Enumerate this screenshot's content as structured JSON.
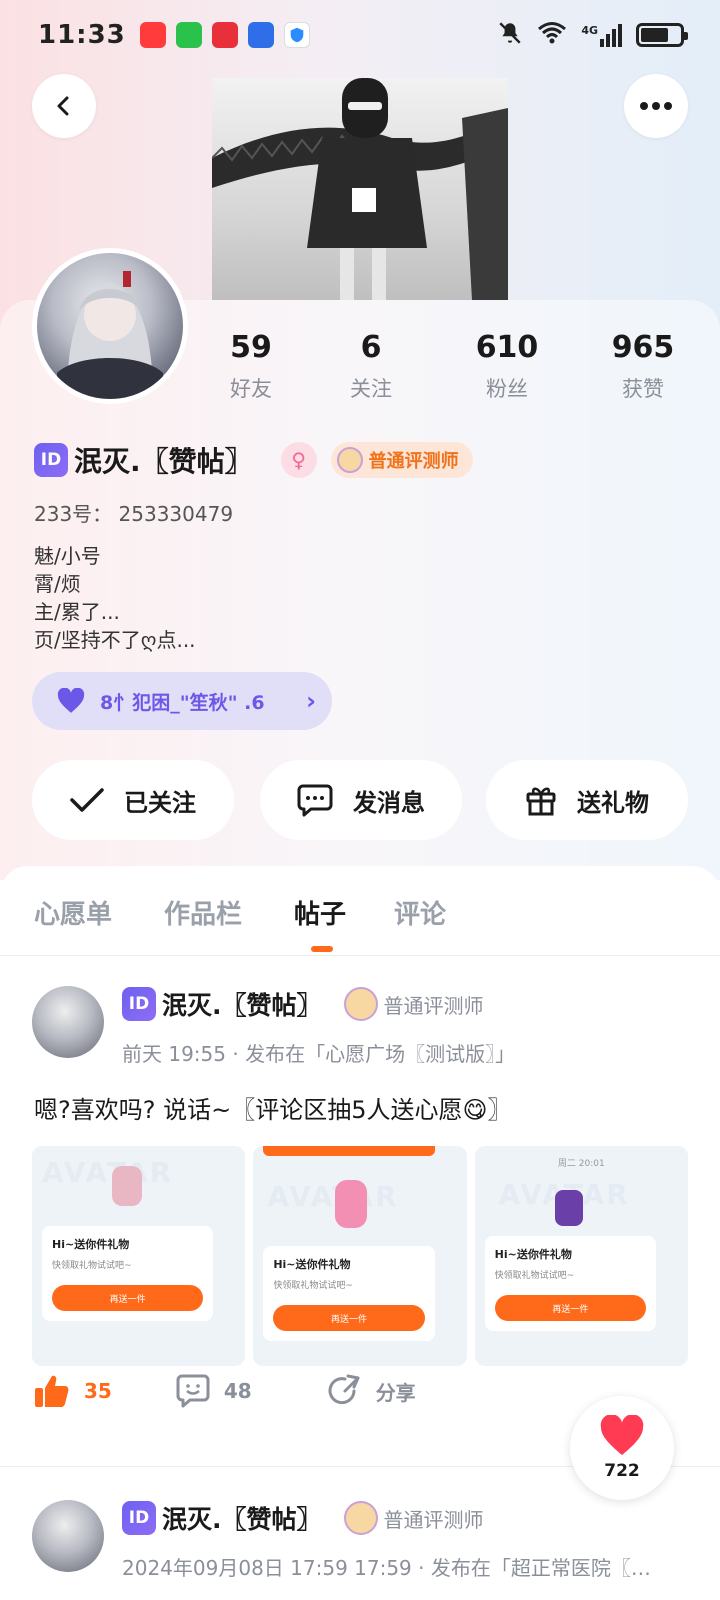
{
  "status_bar": {
    "time": "11:33",
    "network": "4G",
    "apps": [
      {
        "name": "app-icon-1",
        "color": "#ff3b3b",
        "label": ""
      },
      {
        "name": "app-icon-2",
        "color": "#2bc24b",
        "label": ""
      },
      {
        "name": "app-icon-3",
        "color": "#e8303a",
        "label": ""
      },
      {
        "name": "app-icon-4",
        "color": "#2f6ee8",
        "label": ""
      },
      {
        "name": "app-icon-5",
        "color": "#2a8cff",
        "label": ""
      }
    ]
  },
  "profile": {
    "stats": [
      {
        "value": "59",
        "label": "好友"
      },
      {
        "value": "6",
        "label": "关注"
      },
      {
        "value": "610",
        "label": "粉丝"
      },
      {
        "value": "965",
        "label": "获赞"
      }
    ],
    "id_badge": "ID",
    "name": "泯灭.〖赞帖〗",
    "gender_symbol": "♀",
    "role": "普通评测师",
    "uid": "233号：  253330479",
    "bio": [
      "魅/小号",
      "霄/烦",
      "主/累了...",
      "页/坚持不了ღ点..."
    ],
    "guild": "8忄犯困_\"笙秋\" .6",
    "actions": {
      "follow": "已关注",
      "message": "发消息",
      "gift": "送礼物"
    }
  },
  "tabs": [
    "心愿单",
    "作品栏",
    "帖子",
    "评论"
  ],
  "active_tab": "帖子",
  "posts": [
    {
      "author": "泯灭.〖赞帖〗",
      "role": "普通评测师",
      "meta": "前天 19:55 · 发布在「心愿广场〖测试版〗」",
      "text": "嗯?喜欢吗? 说话~〖评论区抽5人送心愿😋〗",
      "images": [
        {
          "card_title": "Hi~送你件礼物",
          "card_sub": "快领取礼物试试吧~",
          "card_btn": "再送一件",
          "watermark": "AVATAR"
        },
        {
          "card_title": "Hi~送你件礼物",
          "card_sub": "快领取礼物试试吧~",
          "card_btn": "再送一件",
          "watermark": "AVATAR"
        },
        {
          "card_title": "Hi~送你件礼物",
          "card_sub": "快领取礼物试试吧~",
          "card_btn": "再送一件",
          "watermark": "AVATAR",
          "time": "周二 20:01"
        }
      ],
      "likes": "35",
      "comments": "48",
      "share": "分享"
    },
    {
      "author": "泯灭.〖赞帖〗",
      "role": "普通评测师",
      "meta": "2024年09月08日 17:59 17:59 · 发布在「超正常医院〖…"
    }
  ],
  "float_like": {
    "count": "722"
  },
  "colors": {
    "accent": "#ff6a1a",
    "purple": "#6b57e8",
    "like_red": "#ff3b53"
  }
}
